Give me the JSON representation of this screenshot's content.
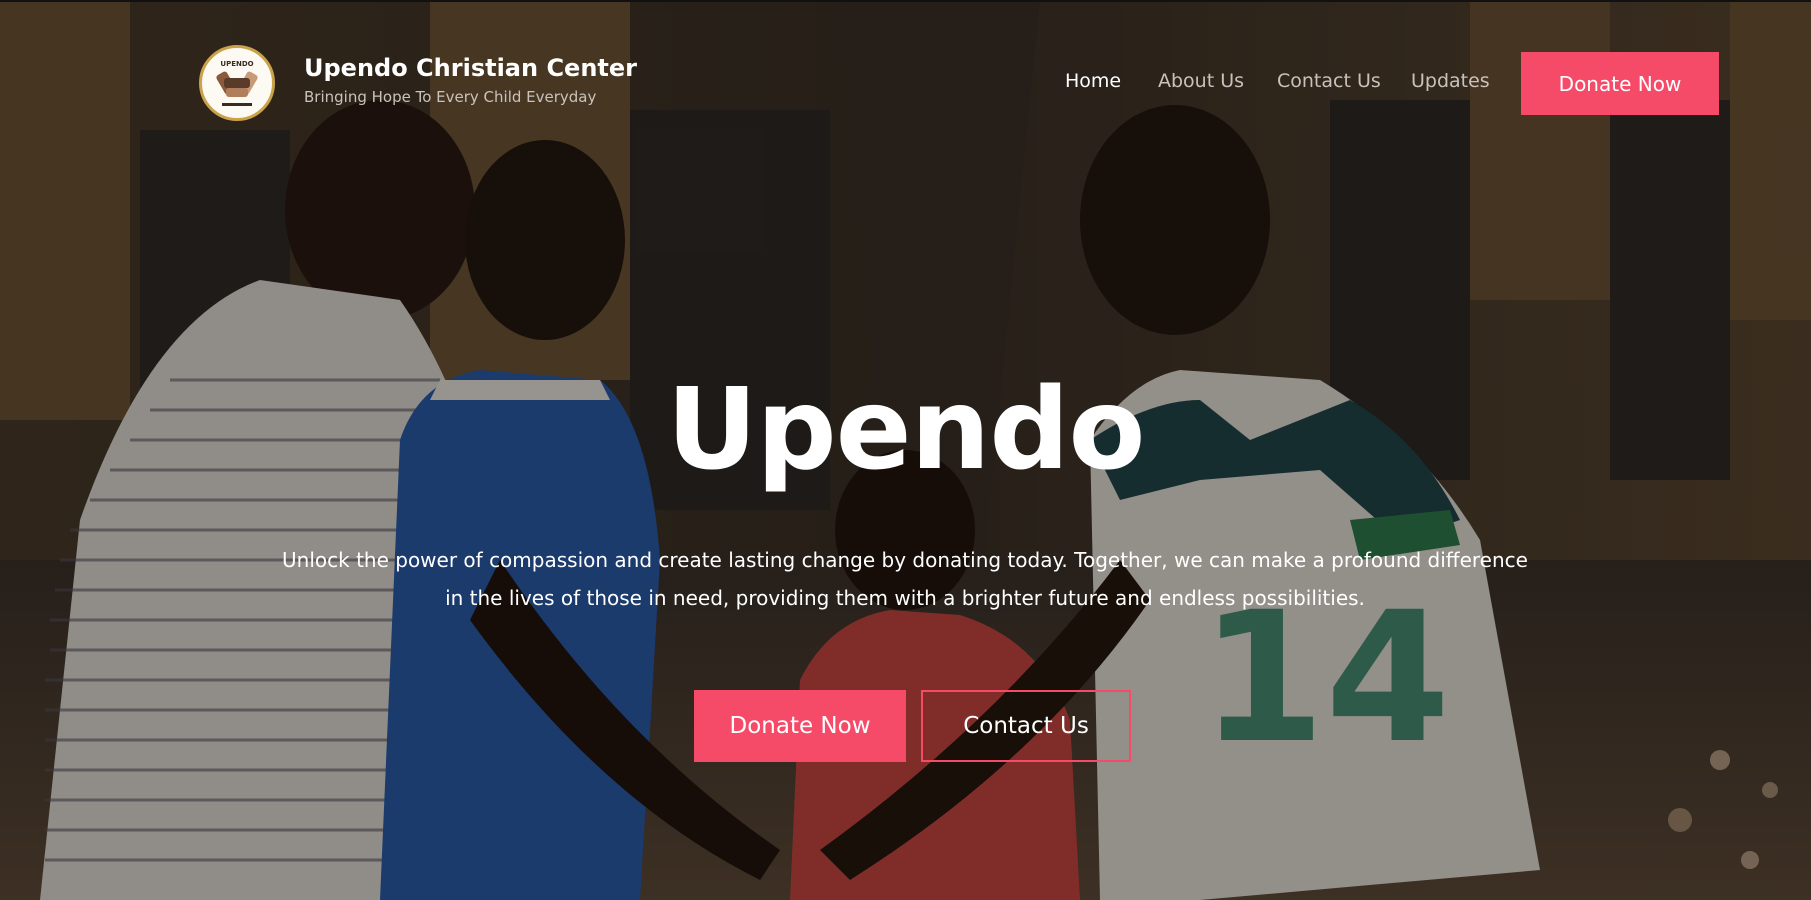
{
  "brand": {
    "name": "Upendo Christian Center",
    "tagline": "Bringing Hope To Every Child Everyday",
    "logo_text": "UPENDO"
  },
  "nav": {
    "items": [
      {
        "label": "Home",
        "active": true
      },
      {
        "label": "About Us",
        "active": false
      },
      {
        "label": "Contact Us",
        "active": false
      },
      {
        "label": "Updates",
        "active": false
      }
    ],
    "donate_label": "Donate Now"
  },
  "hero": {
    "title": "Upendo",
    "text": "Unlock the power of compassion and create lasting change by donating today. Together, we can make a profound difference in the lives of those in need, providing them with a brighter future and endless possibilities.",
    "primary_button": "Donate Now",
    "secondary_button": "Contact Us",
    "background": "photo-of-children-joining-hands"
  },
  "colors": {
    "accent": "#f54b69",
    "text": "#ffffff",
    "muted_nav": "#c8c2bc"
  }
}
